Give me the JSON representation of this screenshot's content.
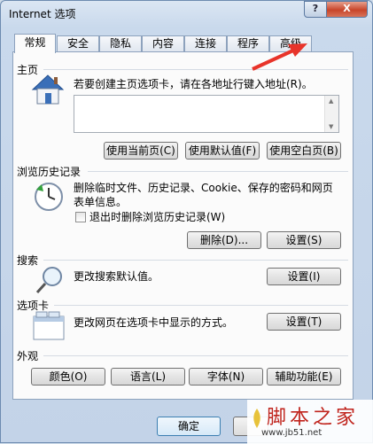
{
  "window": {
    "title": "Internet 选项",
    "help_label": "?",
    "close_label": "X"
  },
  "tabs": [
    "常规",
    "安全",
    "隐私",
    "内容",
    "连接",
    "程序",
    "高级"
  ],
  "home": {
    "heading": "主页",
    "description": "若要创建主页选项卡，请在各地址行键入地址(R)。",
    "buttons": [
      "使用当前页(C)",
      "使用默认值(F)",
      "使用空白页(B)"
    ]
  },
  "history": {
    "heading": "浏览历史记录",
    "description": "删除临时文件、历史记录、Cookie、保存的密码和网页表单信息。",
    "checkbox_label": "退出时删除浏览历史记录(W)",
    "delete_button": "删除(D)...",
    "settings_button": "设置(S)"
  },
  "search": {
    "heading": "搜索",
    "description": "更改搜索默认值。",
    "settings_button": "设置(I)"
  },
  "tabs_section": {
    "heading": "选项卡",
    "description": "更改网页在选项卡中显示的方式。",
    "settings_button": "设置(T)"
  },
  "appearance": {
    "heading": "外观",
    "buttons": [
      "颜色(O)",
      "语言(L)",
      "字体(N)",
      "辅助功能(E)"
    ]
  },
  "footer": {
    "ok_label": "确定"
  },
  "watermark": {
    "name": "脚本之家",
    "url": "www.jb51.net"
  },
  "colors": {
    "annotation_arrow": "#e8342a",
    "close_button": "#c8452a"
  }
}
